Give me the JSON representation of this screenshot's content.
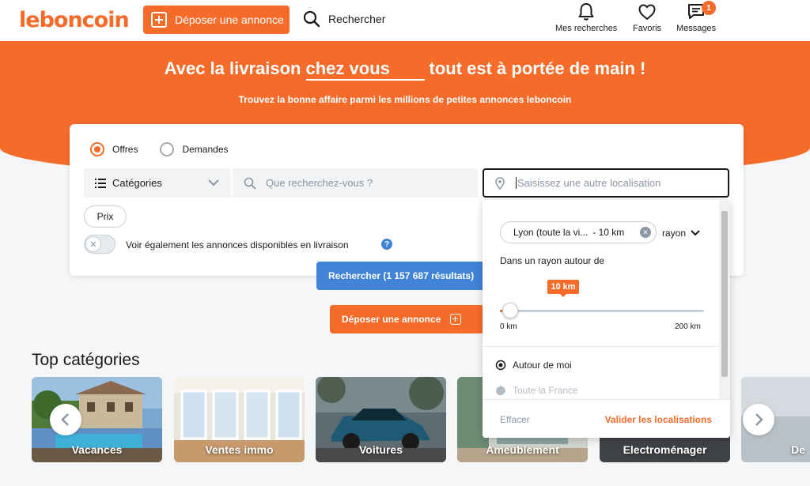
{
  "header": {
    "logo": "leboncoin",
    "post_ad_label": "Déposer une annonce",
    "search_label": "Rechercher",
    "nav": [
      {
        "label": "Mes recherches",
        "icon": "bell-icon"
      },
      {
        "label": "Favoris",
        "icon": "heart-icon"
      },
      {
        "label": "Messages",
        "icon": "message-icon",
        "badge": "1"
      }
    ]
  },
  "hero": {
    "title_before": "Avec la livraison",
    "title_highlight": "chez vous",
    "title_after": "tout est à portée de main !",
    "subtitle": "Trouvez la bonne affaire parmi les millions de petites annonces leboncoin"
  },
  "search": {
    "radio_offers": "Offres",
    "radio_requests": "Demandes",
    "selected_radio": "Offres",
    "categories_label": "Catégories",
    "query_placeholder": "Que recherchez-vous ?",
    "location_placeholder": "Saisissez une autre localisation",
    "price_chip": "Prix",
    "delivery_toggle_label": "Voir également les annonces disponibles en livraison",
    "delivery_toggle_on": false,
    "search_button": "Rechercher (1 157 687 résultats)",
    "post_ad_button": "Déposer une annonce"
  },
  "location_dropdown": {
    "chip_city": "Lyon (toute la vi...",
    "chip_radius": "- 10 km",
    "radius_select": "rayon",
    "radius_label": "Dans un rayon autour de",
    "slider_value_label": "10 km",
    "slider_value_km": 10,
    "slider_max_km": 200,
    "min_label": "0 km",
    "max_label": "200 km",
    "option_near_me": "Autour de moi",
    "option_all_france": "Toute la France",
    "clear_button": "Effacer",
    "validate_button": "Valider les localisations"
  },
  "top_categories": {
    "title": "Top catégories",
    "items": [
      {
        "label": "Vacances"
      },
      {
        "label": "Ventes immo"
      },
      {
        "label": "Voitures"
      },
      {
        "label": "Ameublement"
      },
      {
        "label": "Electroménager"
      },
      {
        "label": "De"
      }
    ]
  },
  "colors": {
    "brand_orange": "#f56b2a",
    "search_blue": "#4183d7"
  }
}
